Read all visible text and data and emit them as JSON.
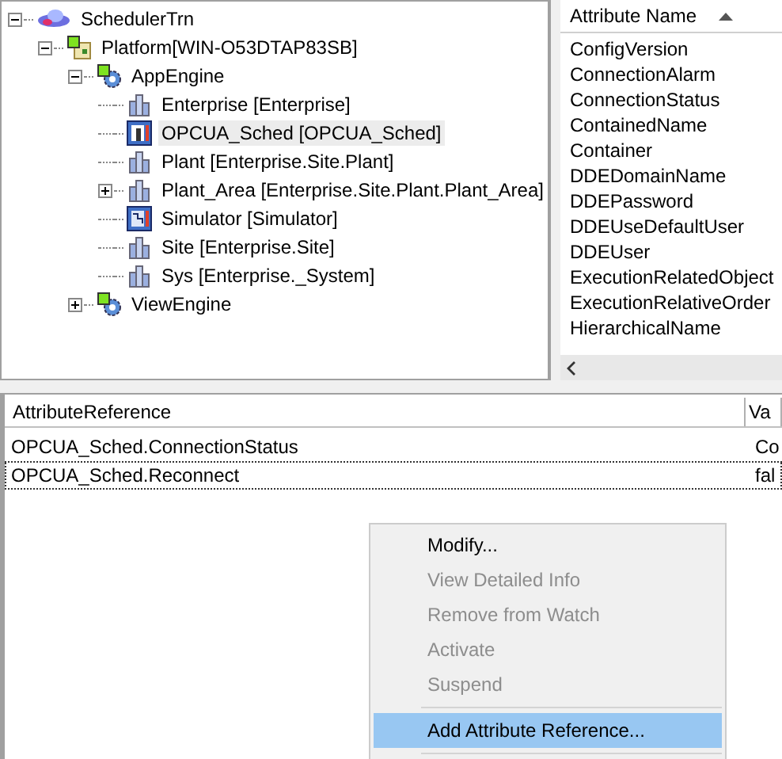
{
  "tree": [
    {
      "label": "SchedulerTrn",
      "kind": "galaxy",
      "expanded": true,
      "selected": false,
      "children": [
        {
          "label": "Platform[WIN-O53DTAP83SB]",
          "kind": "platform",
          "expanded": true,
          "selected": false,
          "children": [
            {
              "label": "AppEngine",
              "kind": "engine",
              "expanded": true,
              "selected": false,
              "children": [
                {
                  "label": "Enterprise [Enterprise]",
                  "kind": "area",
                  "selected": false
                },
                {
                  "label": "OPCUA_Sched [OPCUA_Sched]",
                  "kind": "object",
                  "selected": true
                },
                {
                  "label": "Plant [Enterprise.Site.Plant]",
                  "kind": "area",
                  "selected": false
                },
                {
                  "label": "Plant_Area [Enterprise.Site.Plant.Plant_Area]",
                  "kind": "area",
                  "expanded": false,
                  "selected": false
                },
                {
                  "label": "Simulator [Simulator]",
                  "kind": "simulator",
                  "selected": false
                },
                {
                  "label": "Site [Enterprise.Site]",
                  "kind": "area",
                  "selected": false
                },
                {
                  "label": "Sys [Enterprise._System]",
                  "kind": "area",
                  "selected": false
                }
              ]
            },
            {
              "label": "ViewEngine",
              "kind": "engine",
              "expanded": false,
              "selected": false
            }
          ]
        }
      ]
    }
  ],
  "attribute_list": {
    "header": "Attribute Name",
    "items": [
      "ConfigVersion",
      "ConnectionAlarm",
      "ConnectionStatus",
      "ContainedName",
      "Container",
      "DDEDomainName",
      "DDEPassword",
      "DDEUseDefaultUser",
      "DDEUser",
      "ExecutionRelatedObject",
      "ExecutionRelativeOrder",
      "HierarchicalName"
    ]
  },
  "watch_table": {
    "columns": [
      "AttributeReference",
      "Va"
    ],
    "rows": [
      {
        "cells": [
          "OPCUA_Sched.ConnectionStatus",
          "Co"
        ],
        "focused": false
      },
      {
        "cells": [
          "OPCUA_Sched.Reconnect",
          "fal"
        ],
        "focused": true
      }
    ]
  },
  "context_menu": [
    {
      "label": "Modify...",
      "disabled": false,
      "selected": false
    },
    {
      "label": "View Detailed Info",
      "disabled": true,
      "selected": false
    },
    {
      "label": "Remove from Watch",
      "disabled": true,
      "selected": false
    },
    {
      "label": "Activate",
      "disabled": true,
      "selected": false
    },
    {
      "label": "Suspend",
      "disabled": true,
      "selected": false
    },
    {
      "label": "Add Attribute Reference...",
      "disabled": false,
      "selected": true,
      "separator_before": true
    }
  ]
}
